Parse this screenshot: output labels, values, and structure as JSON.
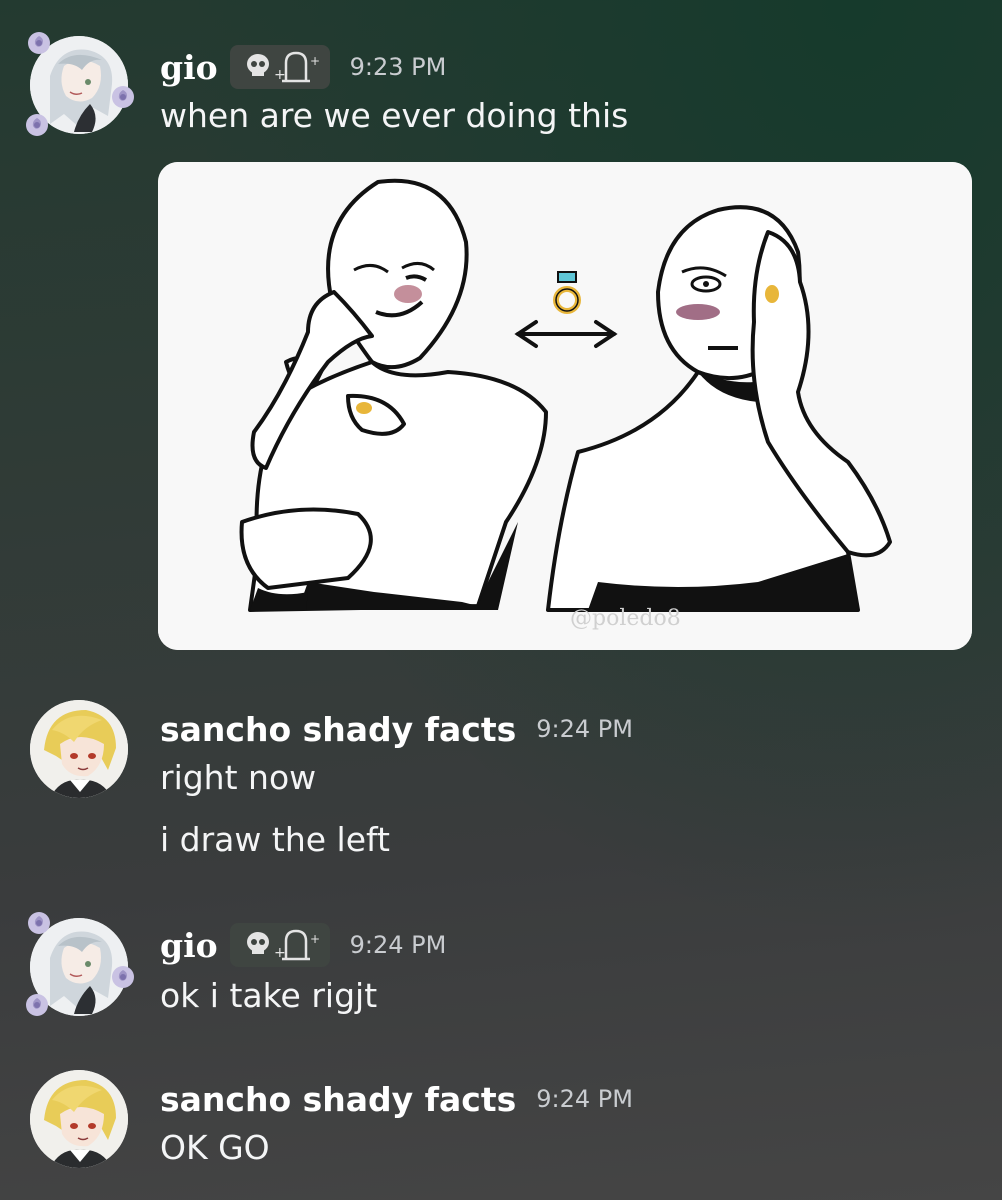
{
  "messages": [
    {
      "author": "gio",
      "timestamp": "9:23 PM",
      "lines": [
        "when are we ever doing this"
      ],
      "tag_icons": [
        "skull-icon",
        "tombstone-icon"
      ]
    },
    {
      "author": "sancho shady facts",
      "timestamp": "9:24 PM",
      "lines": [
        "right now",
        "i draw the left"
      ]
    },
    {
      "author": "gio",
      "timestamp": "9:24 PM",
      "lines": [
        "ok i take rigjt"
      ],
      "tag_icons": [
        "skull-icon",
        "tombstone-icon"
      ]
    },
    {
      "author": "sancho shady facts",
      "timestamp": "9:24 PM",
      "lines": [
        "OK GO"
      ]
    }
  ],
  "attachment": {
    "watermark": "@poledo8",
    "icons": [
      "ring-icon",
      "double-arrow-icon"
    ]
  },
  "colors": {
    "username": "#ffffff",
    "timestamp": "#c9ccd0",
    "text": "#f4f5f6",
    "tag_background": "#3f4541",
    "ring_gem": "#5fc6d6",
    "ring_band": "#e8b63a",
    "blush": "#b06a7a"
  }
}
